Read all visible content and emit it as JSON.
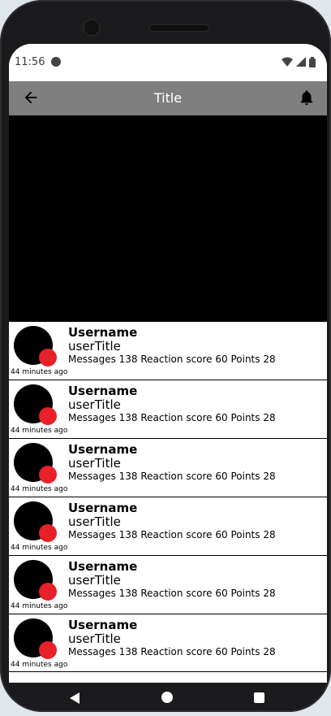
{
  "status_bar": {
    "time": "11:56"
  },
  "app_bar": {
    "title": "Title"
  },
  "feed": {
    "items": [
      {
        "username": "Username",
        "user_title": "userTitle",
        "stats": "Messages 138 Reaction score 60 Points 28",
        "time_ago": "44 minutes ago"
      },
      {
        "username": "Username",
        "user_title": "userTitle",
        "stats": "Messages 138 Reaction score 60 Points 28",
        "time_ago": "44 minutes ago"
      },
      {
        "username": "Username",
        "user_title": "userTitle",
        "stats": "Messages 138 Reaction score 60 Points 28",
        "time_ago": "44 minutes ago"
      },
      {
        "username": "Username",
        "user_title": "userTitle",
        "stats": "Messages 138 Reaction score 60 Points 28",
        "time_ago": "44 minutes ago"
      },
      {
        "username": "Username",
        "user_title": "userTitle",
        "stats": "Messages 138 Reaction score 60 Points 28",
        "time_ago": "44 minutes ago"
      },
      {
        "username": "Username",
        "user_title": "userTitle",
        "stats": "Messages 138 Reaction score 60 Points 28",
        "time_ago": "44 minutes ago"
      }
    ]
  },
  "colors": {
    "app_bar": "#7f7f7f",
    "badge": "#e8202a",
    "media": "#000000"
  },
  "icons": {
    "back": "arrow-left-icon",
    "notifications": "bell-icon",
    "wifi": "wifi-icon",
    "signal": "signal-icon",
    "battery": "battery-icon"
  }
}
